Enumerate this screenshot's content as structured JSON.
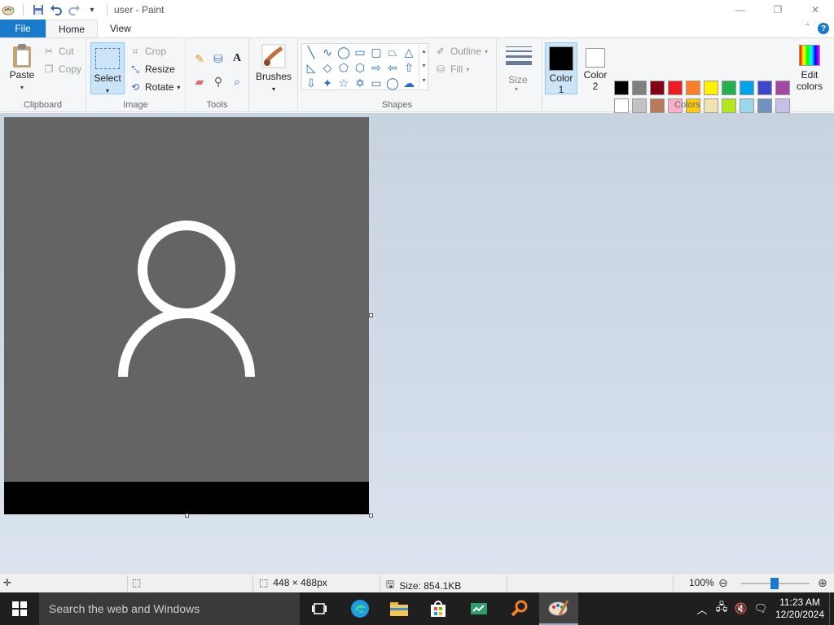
{
  "window": {
    "title": "user - Paint",
    "controls": {
      "minimize": "—",
      "maximize": "❐",
      "close": "✕"
    }
  },
  "tabs": [
    {
      "label": "File"
    },
    {
      "label": "Home"
    },
    {
      "label": "View"
    }
  ],
  "ribbon": {
    "clipboard": {
      "label": "Clipboard",
      "paste": "Paste",
      "cut": "Cut",
      "copy": "Copy"
    },
    "image": {
      "label": "Image",
      "select": "Select",
      "crop": "Crop",
      "resize": "Resize",
      "rotate": "Rotate"
    },
    "tools": {
      "label": "Tools"
    },
    "brushes": {
      "label": "Brushes"
    },
    "shapes": {
      "label": "Shapes",
      "outline": "Outline",
      "fill": "Fill"
    },
    "size": {
      "label": "Size"
    },
    "colors": {
      "label": "Colors",
      "color1_line1": "Color",
      "color1_line2": "1",
      "color2_line1": "Color",
      "color2_line2": "2",
      "color1": "#000000",
      "color2": "#ffffff",
      "edit_line1": "Edit",
      "edit_line2": "colors",
      "palette_row1": [
        "#000000",
        "#7f7f7f",
        "#880015",
        "#ed1c24",
        "#ff7f27",
        "#fff200",
        "#22b14c",
        "#00a2e8",
        "#3f48cc",
        "#a349a4"
      ],
      "palette_row2": [
        "#ffffff",
        "#c3c3c3",
        "#b97a57",
        "#ffaec9",
        "#ffc90e",
        "#efe4b0",
        "#b5e61d",
        "#99d9ea",
        "#7092be",
        "#c8bfe7"
      ],
      "palette_row3": [
        "#ffffff",
        "#ffffff",
        "#ffffff",
        "#ffffff",
        "#ffffff",
        "#ffffff",
        "#ffffff",
        "#ffffff",
        "#ffffff",
        "#ffffff"
      ]
    }
  },
  "canvas": {
    "background": "#646464",
    "band": "#000000"
  },
  "status": {
    "dimensions": "448 × 488px",
    "size": "Size: 854.1KB",
    "zoom": "100%"
  },
  "taskbar": {
    "search_placeholder": "Search the web and Windows",
    "time": "11:23 AM",
    "date": "12/20/2024"
  }
}
